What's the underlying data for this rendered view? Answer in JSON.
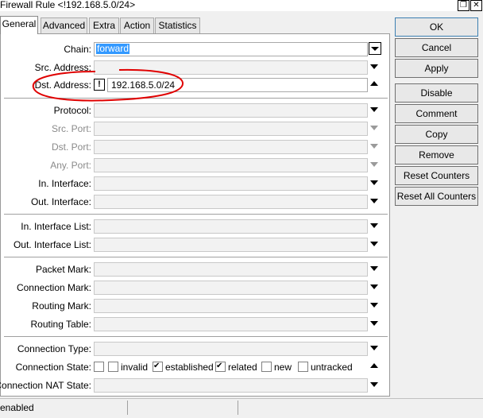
{
  "window": {
    "title": "Firewall Rule <!192.168.5.0/24>",
    "restore_icon": "restore-icon",
    "close_icon": "close-icon"
  },
  "tabs": [
    {
      "label": "General",
      "active": true
    },
    {
      "label": "Advanced",
      "active": false
    },
    {
      "label": "Extra",
      "active": false
    },
    {
      "label": "Action",
      "active": false
    },
    {
      "label": "Statistics",
      "active": false
    }
  ],
  "form": {
    "chain": {
      "label": "Chain:",
      "value": "forward"
    },
    "src_address": {
      "label": "Src. Address:",
      "value": ""
    },
    "dst_address": {
      "label": "Dst. Address:",
      "negate": "!",
      "value": "192.168.5.0/24"
    },
    "protocol": {
      "label": "Protocol:",
      "value": ""
    },
    "src_port": {
      "label": "Src. Port:",
      "value": ""
    },
    "dst_port": {
      "label": "Dst. Port:",
      "value": ""
    },
    "any_port": {
      "label": "Any. Port:",
      "value": ""
    },
    "in_interface": {
      "label": "In. Interface:",
      "value": ""
    },
    "out_interface": {
      "label": "Out. Interface:",
      "value": ""
    },
    "in_interface_list": {
      "label": "In. Interface List:",
      "value": ""
    },
    "out_interface_list": {
      "label": "Out. Interface List:",
      "value": ""
    },
    "packet_mark": {
      "label": "Packet Mark:",
      "value": ""
    },
    "connection_mark": {
      "label": "Connection Mark:",
      "value": ""
    },
    "routing_mark": {
      "label": "Routing Mark:",
      "value": ""
    },
    "routing_table": {
      "label": "Routing Table:",
      "value": ""
    },
    "connection_type": {
      "label": "Connection Type:",
      "value": ""
    },
    "connection_state": {
      "label": "Connection State:",
      "options": [
        {
          "label": "",
          "checked": false
        },
        {
          "label": "invalid",
          "checked": false
        },
        {
          "label": "established",
          "checked": true
        },
        {
          "label": "related",
          "checked": true
        },
        {
          "label": "new",
          "checked": false
        },
        {
          "label": "untracked",
          "checked": false
        }
      ]
    },
    "connection_nat_state": {
      "label": "Connection NAT State:",
      "value": ""
    }
  },
  "buttons": {
    "ok": "OK",
    "cancel": "Cancel",
    "apply": "Apply",
    "disable": "Disable",
    "comment": "Comment",
    "copy": "Copy",
    "remove": "Remove",
    "reset_counters": "Reset Counters",
    "reset_all_counters": "Reset All Counters"
  },
  "status": {
    "state": "enabled"
  },
  "colors": {
    "selection": "#3399ff",
    "annotation": "#e00000"
  }
}
